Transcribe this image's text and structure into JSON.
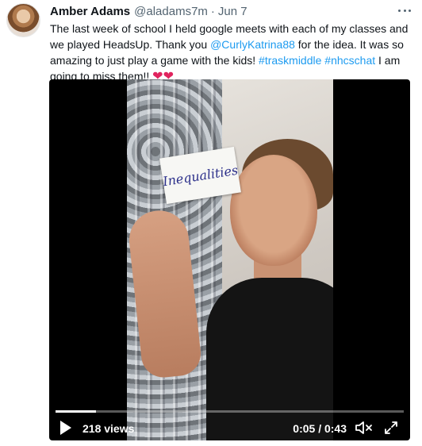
{
  "tweet": {
    "author_name": "Amber Adams",
    "author_handle": "@aladams7m",
    "separator": "·",
    "date": "Jun 7",
    "text_parts": {
      "p1": "The last week of school I held google meets with each of my classes and we played HeadsUp. Thank you ",
      "mention": "@CurlyKatrina88",
      "p2": " for the idea. It was so amazing to just play a game with the kids! ",
      "hashtag1": "#traskmiddle",
      "space": " ",
      "hashtag2": "#nhcschat",
      "p3": " I am going to miss them!! ",
      "hearts": "❤❤"
    }
  },
  "video": {
    "card_word": "Inequalities",
    "views": "218 views",
    "time": "0:05 / 0:43",
    "progress_fraction": 0.116
  },
  "colors": {
    "link": "#1d9bf0",
    "heart": "#e0245e",
    "muted_text": "#536471"
  },
  "icons": [
    "more-icon",
    "play-icon",
    "mute-icon",
    "fullscreen-icon"
  ]
}
